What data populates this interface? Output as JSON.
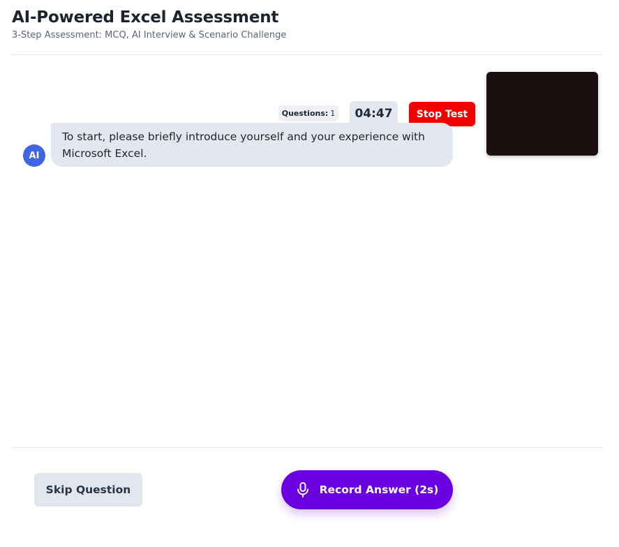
{
  "header": {
    "title": "AI-Powered Excel Assessment",
    "subtitle": "3-Step Assessment: MCQ, AI Interview & Scenario Challenge"
  },
  "toolbar": {
    "questions_label": "Questions:",
    "questions_count": "1",
    "timer": "04:47",
    "stop_label": "Stop Test"
  },
  "chat": {
    "messages": [
      {
        "sender_initials": "AI",
        "text": "To start, please briefly introduce yourself and your experience with Microsoft Excel."
      }
    ]
  },
  "footer": {
    "skip_label": "Skip Question",
    "record_label": "Record Answer (2s)",
    "record_icon": "microphone-icon"
  },
  "colors": {
    "stop": "#f20000",
    "record": "#6a00e0",
    "avatar": "#3f64e4",
    "bubble": "#e2e7f0"
  }
}
